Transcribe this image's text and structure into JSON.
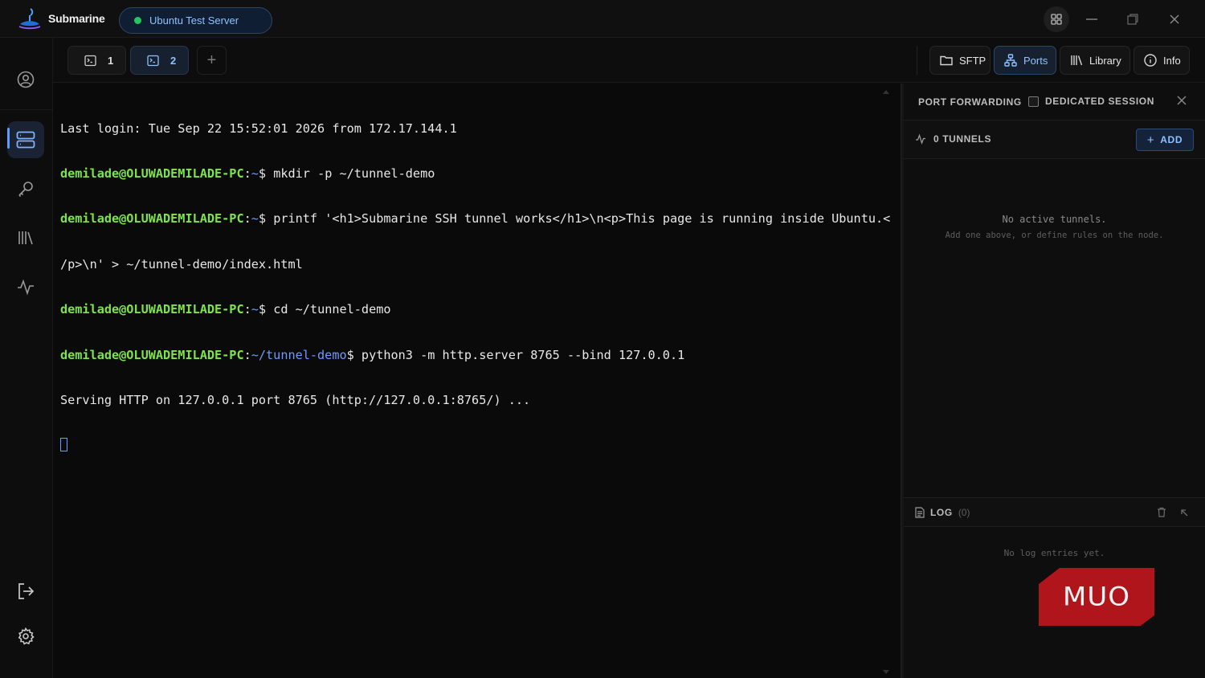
{
  "app": {
    "name": "Submarine",
    "server_name": "Ubuntu Test Server",
    "server_status_color": "#22c55e"
  },
  "window_controls": [
    "grid-icon",
    "minimize-icon",
    "restore-icon",
    "close-icon"
  ],
  "sidebar": {
    "items": [
      {
        "name": "profile",
        "icon": "user-circle-icon",
        "active": false
      },
      {
        "name": "servers",
        "icon": "server-icon",
        "active": true
      },
      {
        "name": "keys",
        "icon": "key-icon",
        "active": false
      },
      {
        "name": "library",
        "icon": "library-icon",
        "active": false
      },
      {
        "name": "activity",
        "icon": "activity-icon",
        "active": false
      }
    ],
    "bottom_items": [
      {
        "name": "logout",
        "icon": "logout-icon"
      },
      {
        "name": "settings",
        "icon": "gear-icon"
      }
    ]
  },
  "tabs": [
    {
      "label": "1",
      "active": false
    },
    {
      "label": "2",
      "active": true
    }
  ],
  "toolbar": {
    "sftp": "SFTP",
    "ports": "Ports",
    "library": "Library",
    "info": "Info"
  },
  "terminal": {
    "line1": "Last login: Tue Sep 22 15:52:01 2026 from 172.17.144.1",
    "user": "demilade@OLUWADEMILADE-PC",
    "home_path": "~",
    "demo_path": "~/tunnel-demo",
    "cmd1": "mkdir -p ~/tunnel-demo",
    "cmd2_a": "printf '<h1>Submarine SSH tunnel works</h1>\\n<p>This page is running inside Ubuntu.<",
    "cmd2_b": "/p>\\n' > ~/tunnel-demo/index.html",
    "cmd3": "cd ~/tunnel-demo",
    "cmd4": "python3 -m http.server 8765 --bind 127.0.0.1",
    "output1": "Serving HTTP on 127.0.0.1 port 8765 (http://127.0.0.1:8765/) ..."
  },
  "panel": {
    "title": "PORT FORWARDING",
    "dedicated_label": "DEDICATED SESSION",
    "dedicated_checked": false,
    "tunnels_label": "0 TUNNELS",
    "add_label": "ADD",
    "empty_main": "No active tunnels.",
    "empty_sub": "Add one above, or define rules on the node.",
    "log_label": "LOG",
    "log_count": "(0)",
    "log_empty": "No log entries yet."
  },
  "watermark": {
    "text": "MUO",
    "color": "#b0151c"
  }
}
